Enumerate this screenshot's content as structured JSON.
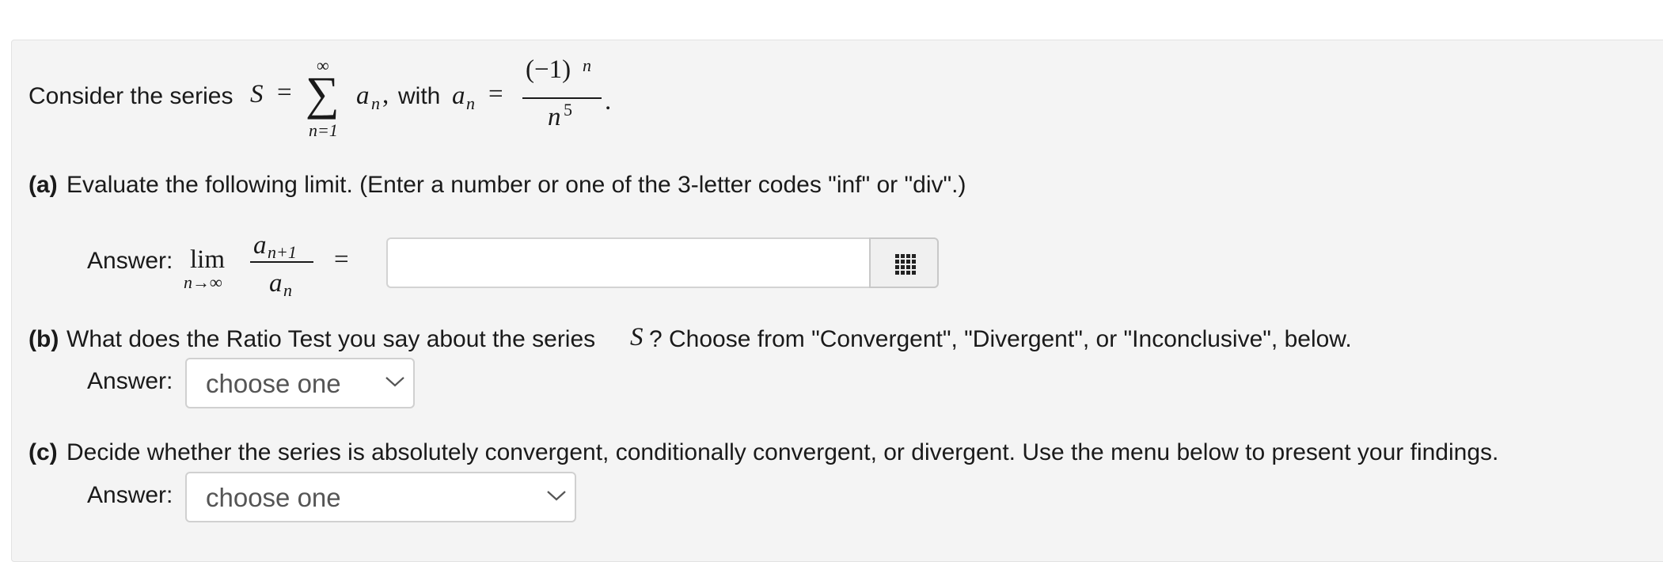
{
  "intro": {
    "text_before": "Consider the series",
    "S": "S",
    "equals": "=",
    "sum_symbol": "∑",
    "sum_upper": "∞",
    "sum_lower": "n=1",
    "a": "a",
    "n": "n",
    "comma": ",",
    "with": "with",
    "an_a": "a",
    "an_n": "n",
    "equals2": "=",
    "numerator": "(−1)",
    "numerator_exp": "n",
    "denominator": "n",
    "denominator_exp": "5",
    "period": "."
  },
  "part_a": {
    "label": "(a)",
    "text": "Evaluate the following limit. (Enter a number or one of the 3-letter codes \"inf\" or \"div\".)",
    "answer_label": "Answer:",
    "lim": "lim",
    "lim_sub": "n→∞",
    "frac_num_a": "a",
    "frac_num_sub": "n+1",
    "frac_den_a": "a",
    "frac_den_sub": "n",
    "equals": "=",
    "input_value": "",
    "keyboard_icon": "keypad-icon"
  },
  "part_b": {
    "label": "(b)",
    "text_before": "What does the Ratio Test you say about the series",
    "S": "S",
    "text_after": "? Choose from \"Convergent\", \"Divergent\", or \"Inconclusive\", below.",
    "answer_label": "Answer:",
    "select_value": "choose one",
    "chevron_icon": "chevron-down-icon"
  },
  "part_c": {
    "label": "(c)",
    "text": "Decide whether the series is absolutely convergent, conditionally convergent, or divergent. Use the menu below to present your findings.",
    "answer_label": "Answer:",
    "select_value": "choose one",
    "chevron_icon": "chevron-down-icon"
  }
}
